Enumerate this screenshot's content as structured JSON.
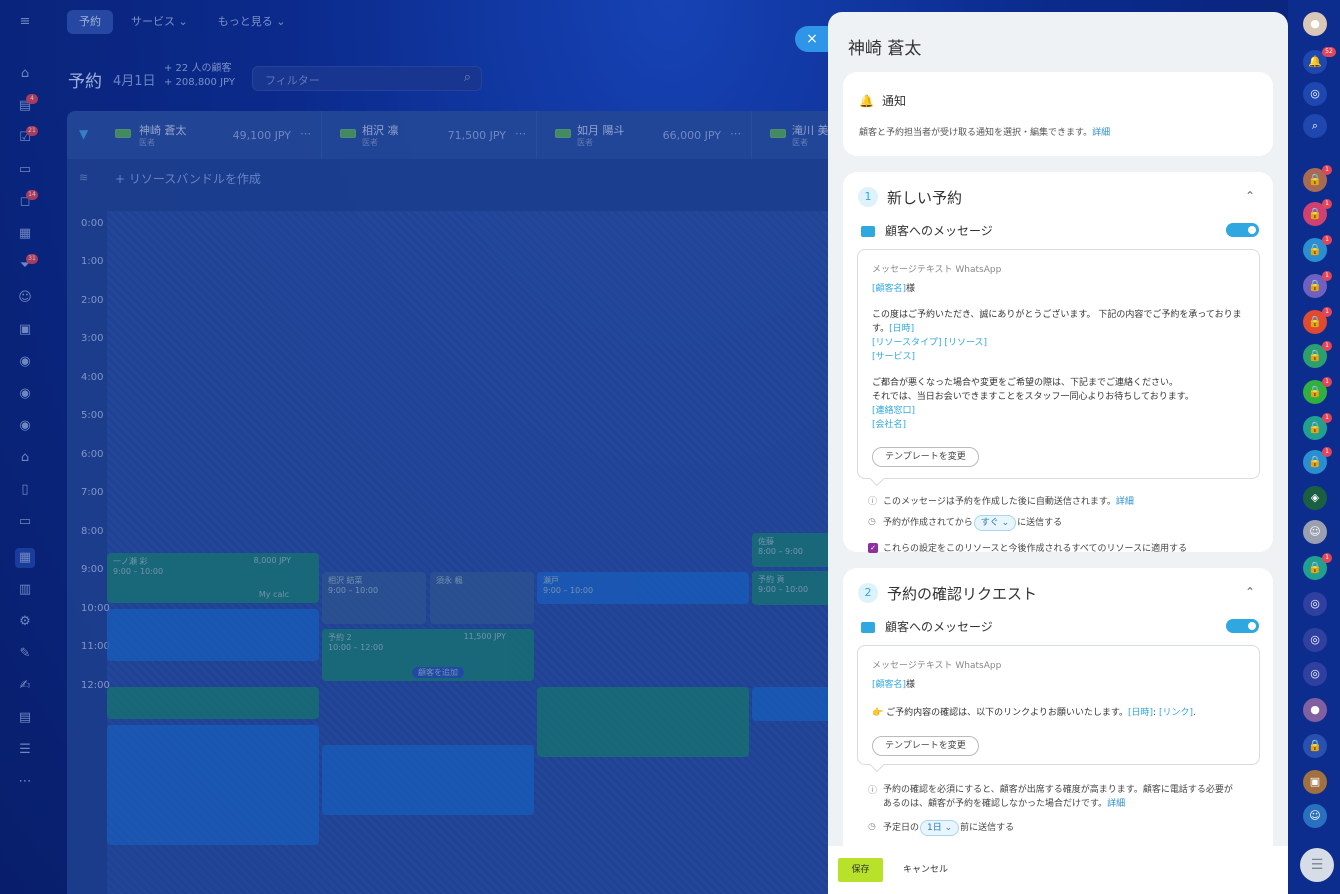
{
  "nav": {
    "tabs": [
      "予約",
      "サービス",
      "もっと見る"
    ]
  },
  "page": {
    "title": "予約",
    "date": "4月1日",
    "stat_clients": "+ 22 人の顧客",
    "stat_amount": "+ 208,800 JPY",
    "filter_placeholder": "フィルター"
  },
  "left_badges": [
    "4",
    "21",
    "14",
    "31"
  ],
  "resources": [
    {
      "name": "神崎 蒼太",
      "role": "医者",
      "amount": "49,100 JPY"
    },
    {
      "name": "相沢 凛",
      "role": "医者",
      "amount": "71,500 JPY"
    },
    {
      "name": "如月 陽斗",
      "role": "医者",
      "amount": "66,000 JPY"
    },
    {
      "name": "滝川 美結",
      "role": "医者",
      "amount": ""
    }
  ],
  "bundle_label": "+ リソースバンドルを作成",
  "times": [
    "0:00",
    "1:00",
    "2:00",
    "3:00",
    "4:00",
    "5:00",
    "6:00",
    "7:00",
    "8:00",
    "9:00",
    "10:00",
    "11:00",
    "12:00"
  ],
  "events": [
    "一ノ瀬 彩",
    "9:00 – 10:00",
    "8,000 JPY",
    "My calc",
    "相沢 結菜",
    "9:00 – 10:00",
    "須永 楓",
    "予約 2",
    "11,500 JPY",
    "10:00 – 12:00",
    "顧客を追加",
    "瀬戸",
    "9:00 – 10:00",
    "佐藤",
    "8:00 – 9:00",
    "予約 頁",
    "9:00 – 10:00"
  ],
  "panel": {
    "title": "神崎 蒼太",
    "close_icon": "×",
    "notify_title": "通知",
    "notify_desc": "顧客と予約担当者が受け取る通知を選択・編集できます。",
    "detail_link": "詳細",
    "section1": {
      "num": "1",
      "title": "新しい予約",
      "msg_label": "顧客へのメッセージ",
      "box_header": "メッセージテキスト WhatsApp",
      "line1_tag": "[顧客名]",
      "line1_suffix": "様",
      "para1": "この度はご予約いただき、誠にありがとうございます。 下記の内容でご予約を承っております。",
      "tag_datetime": "[日時]",
      "tag_restype": "[リソースタイプ]",
      "tag_resource": "[リソース]",
      "tag_service": "[サービス]",
      "para2_1": "ご都合が悪くなった場合や変更をご希望の際は、下記までご連絡ください。",
      "para2_2": "それでは、当日お会いできますことをスタッフ一同心よりお待ちしております。",
      "tag_contact": "[連絡窓口]",
      "tag_company": "[会社名]",
      "tpl_button": "テンプレートを変更",
      "info": "このメッセージは予約を作成した後に自動送信されます。",
      "send_prefix": "予約が作成されてから",
      "send_select": "すぐ",
      "send_suffix": "に送信する",
      "apply_all": "これらの設定をこのリソースと今後作成されるすべてのリソースに適用する"
    },
    "section2": {
      "num": "2",
      "title": "予約の確認リクエスト",
      "msg_label": "顧客へのメッセージ",
      "box_header": "メッセージテキスト WhatsApp",
      "line1_tag": "[顧客名]",
      "line1_suffix": "様",
      "confirm_emoji": "👉",
      "confirm_text": "ご予約内容の確認は、以下のリンクよりお願いいたします。",
      "tag_datetime": "[日時]",
      "colon": ":",
      "tag_link": "[リンク]",
      "period": ".",
      "tpl_button": "テンプレートを変更",
      "info1": "予約の確認を必須にすると、顧客が出席する確度が高まります。顧客に電話する必要が",
      "info2": "あるのは、顧客が予約を確認しなかった場合だけです。",
      "send_prefix": "予定日の",
      "send_select": "1日",
      "send_suffix": "前に送信する"
    },
    "save": "保存",
    "cancel": "キャンセル"
  },
  "right_badges": [
    "52",
    "1",
    "1",
    "1",
    "1",
    "1",
    "1",
    "1",
    "1",
    "1",
    "1"
  ]
}
